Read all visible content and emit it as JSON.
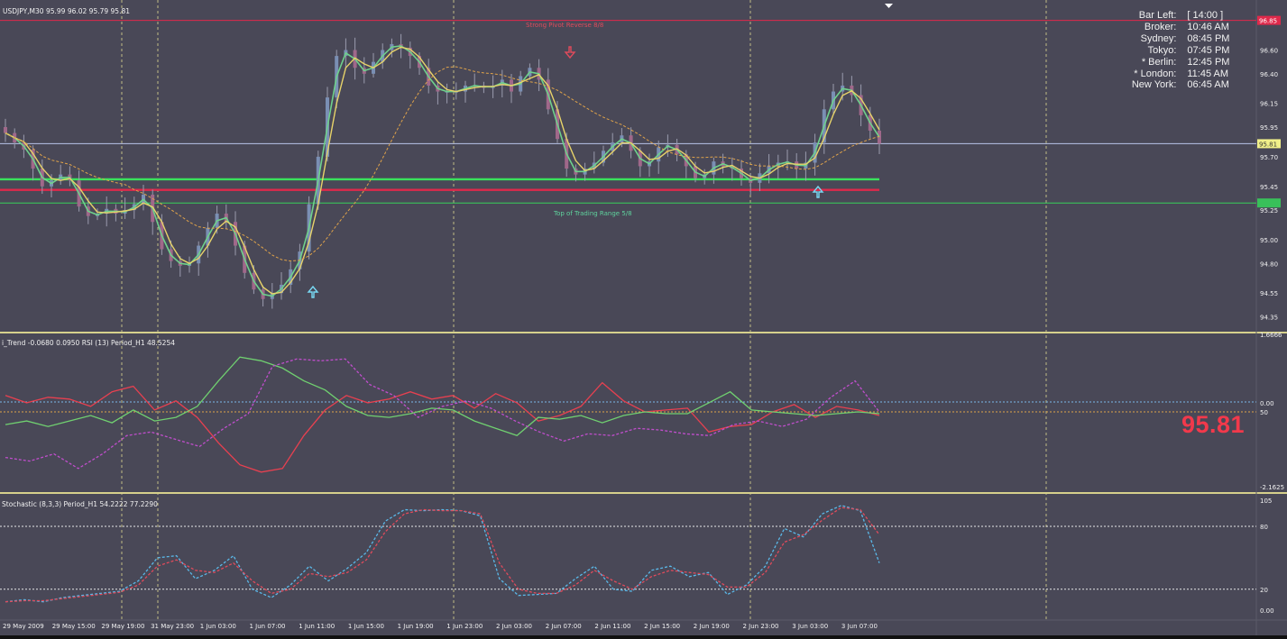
{
  "app": {
    "symbol_header": "USDJPY,M30  95.99 96.02 95.79 95.81",
    "price_label": "95.81",
    "colors": {
      "background": "#494857",
      "panel_separator": "#d6d08c",
      "grid": "#d6d08c",
      "candle": "#8a8d9c",
      "price_line": "#b9c4e8",
      "pivot_line": "#e0294b",
      "support_line": "#39e35c",
      "range_top_line": "#39d05a",
      "pivot_text": "#e04b5c",
      "range_text": "#5fd39d",
      "arrow_up": "#79d9f4",
      "arrow_down": "#e04b5c"
    }
  },
  "market_clock": [
    {
      "label": "Bar Left:",
      "value": "[ 14:00 ]"
    },
    {
      "label": "Broker:",
      "value": "10:46 AM"
    },
    {
      "label": "Sydney:",
      "value": "08:45 PM"
    },
    {
      "label": "Tokyo:",
      "value": "07:45 PM"
    },
    {
      "label": "* Berlin:",
      "value": "12:45 PM"
    },
    {
      "label": "* London:",
      "value": "11:45 AM"
    },
    {
      "label": "New York:",
      "value": "06:45 AM"
    }
  ],
  "annotations": {
    "pivot_text": "Strong  Pivot  Reverse  8/8",
    "range_text": "Top of Trading Range  5/8"
  },
  "chart_data": [
    {
      "type": "candlestick",
      "title": "USDJPY,M30  95.99 96.02 95.79 95.81",
      "x_ticks": [
        "29 May 2009",
        "29 May 15:00",
        "29 May 19:00",
        "31 May 23:00",
        "1 Jun 03:00",
        "1 Jun 07:00",
        "1 Jun 11:00",
        "1 Jun 15:00",
        "1 Jun 19:00",
        "1 Jun 23:00",
        "2 Jun 03:00",
        "2 Jun 07:00",
        "2 Jun 11:00",
        "2 Jun 15:00",
        "2 Jun 19:00",
        "2 Jun 23:00",
        "3 Jun 03:00",
        "3 Jun 07:00"
      ],
      "y_ticks": [
        "96.85",
        "96.60",
        "96.40",
        "96.15",
        "95.95",
        "95.70",
        "95.45",
        "95.25",
        "95.00",
        "94.80",
        "94.55",
        "94.35"
      ],
      "ylim": [
        94.27,
        96.87
      ],
      "closes": [
        95.9,
        95.82,
        95.76,
        95.6,
        95.45,
        95.5,
        95.55,
        95.5,
        95.28,
        95.2,
        95.22,
        95.26,
        95.22,
        95.25,
        95.3,
        95.38,
        95.15,
        94.92,
        94.82,
        94.78,
        94.8,
        94.95,
        95.1,
        95.22,
        95.15,
        94.95,
        94.72,
        94.58,
        94.5,
        94.55,
        94.62,
        94.75,
        94.9,
        95.3,
        95.7,
        96.2,
        96.55,
        96.6,
        96.45,
        96.4,
        96.5,
        96.6,
        96.65,
        96.62,
        96.55,
        96.45,
        96.3,
        96.25,
        96.25,
        96.25,
        96.3,
        96.3,
        96.28,
        96.3,
        96.35,
        96.25,
        96.38,
        96.45,
        96.35,
        96.1,
        95.85,
        95.6,
        95.55,
        95.6,
        95.65,
        95.75,
        95.82,
        95.88,
        95.75,
        95.62,
        95.66,
        95.78,
        95.8,
        95.72,
        95.62,
        95.52,
        95.55,
        95.66,
        95.62,
        95.6,
        95.52,
        95.48,
        95.56,
        95.62,
        95.65,
        95.66,
        95.6,
        95.65,
        95.82,
        96.1,
        96.25,
        96.3,
        96.22,
        96.05,
        95.92,
        95.81
      ],
      "bars_shown_count": 96,
      "horizontal_lines": [
        {
          "name": "price",
          "value": 95.81
        },
        {
          "name": "pivot_8_8",
          "value": 96.85
        },
        {
          "name": "top_of_trading_range",
          "value": 95.31
        },
        {
          "name": "support",
          "value": 95.51
        },
        {
          "name": "resistance_red",
          "value": 95.42
        }
      ]
    },
    {
      "type": "line",
      "title": "i_Trend -0.0680 0.0950  RSI (13) Period_H1 48.5254",
      "y_ticks": [
        "1.6666",
        "0.00",
        "50",
        "-2.1625"
      ],
      "series": [
        {
          "name": "i_Trend",
          "color": "#e84050",
          "values": [
            0.5,
            0.3,
            0.45,
            0.4,
            0.2,
            0.6,
            0.75,
            0.1,
            0.35,
            -0.1,
            -0.8,
            -1.4,
            -1.6,
            -1.5,
            -0.6,
            0.1,
            0.5,
            0.3,
            0.4,
            0.6,
            0.4,
            0.5,
            0.15,
            0.55,
            0.3,
            -0.2,
            -0.05,
            0.2,
            0.85,
            0.35,
            0.05,
            0.1,
            0.15,
            -0.5,
            -0.35,
            -0.3,
            0.05,
            0.25,
            -0.1,
            0.2,
            0.1,
            -0.05
          ]
        },
        {
          "name": "i_Trend signal",
          "color": "#70d070",
          "values": [
            -0.3,
            -0.2,
            -0.35,
            -0.2,
            -0.05,
            -0.25,
            0.1,
            -0.2,
            -0.1,
            0.2,
            0.9,
            1.55,
            1.45,
            1.25,
            0.9,
            0.65,
            0.2,
            -0.05,
            -0.1,
            0.0,
            0.15,
            0.1,
            -0.2,
            -0.4,
            -0.6,
            -0.1,
            -0.15,
            -0.05,
            -0.25,
            -0.05,
            0.05,
            0.0,
            0.0,
            0.3,
            0.6,
            0.1,
            0.05,
            0.0,
            -0.05,
            0.0,
            0.05,
            0.0
          ]
        },
        {
          "name": "RSI (13)",
          "color": "#c04ecc",
          "values": [
            -1.2,
            -1.3,
            -1.1,
            -1.5,
            -1.1,
            -0.6,
            -0.5,
            -0.7,
            -0.9,
            -0.4,
            0.0,
            1.3,
            1.5,
            1.45,
            1.5,
            0.8,
            0.5,
            -0.1,
            0.2,
            0.35,
            0.15,
            -0.2,
            -0.5,
            -0.75,
            -0.55,
            -0.6,
            -0.4,
            -0.45,
            -0.55,
            -0.6,
            -0.3,
            -0.2,
            -0.35,
            -0.15,
            0.45,
            0.9,
            0.05
          ]
        }
      ]
    },
    {
      "type": "line",
      "title": "Stochastic (8,3,3) Period_H1 54.2222 77.2290",
      "y_ticks": [
        "105",
        "80",
        "20",
        "0.00"
      ],
      "ylim": [
        0,
        105
      ],
      "levels": [
        80,
        20
      ],
      "series": [
        {
          "name": "main",
          "color": "#5ab8e8",
          "values": [
            8,
            10,
            8,
            12,
            14,
            16,
            18,
            28,
            50,
            52,
            30,
            38,
            52,
            20,
            12,
            24,
            42,
            28,
            40,
            55,
            85,
            96,
            95,
            96,
            95,
            90,
            30,
            14,
            15,
            16,
            30,
            42,
            20,
            18,
            38,
            42,
            32,
            36,
            15,
            24,
            42,
            78,
            70,
            92,
            100,
            95,
            45
          ]
        },
        {
          "name": "signal",
          "color": "#e04b5c",
          "values": [
            8,
            9,
            9,
            11,
            13,
            15,
            17,
            24,
            42,
            48,
            38,
            36,
            45,
            28,
            16,
            20,
            35,
            32,
            36,
            48,
            75,
            92,
            96,
            95,
            95,
            92,
            45,
            20,
            16,
            16,
            24,
            38,
            28,
            20,
            32,
            38,
            36,
            34,
            22,
            22,
            36,
            65,
            72,
            86,
            98,
            96,
            72
          ]
        }
      ]
    }
  ]
}
